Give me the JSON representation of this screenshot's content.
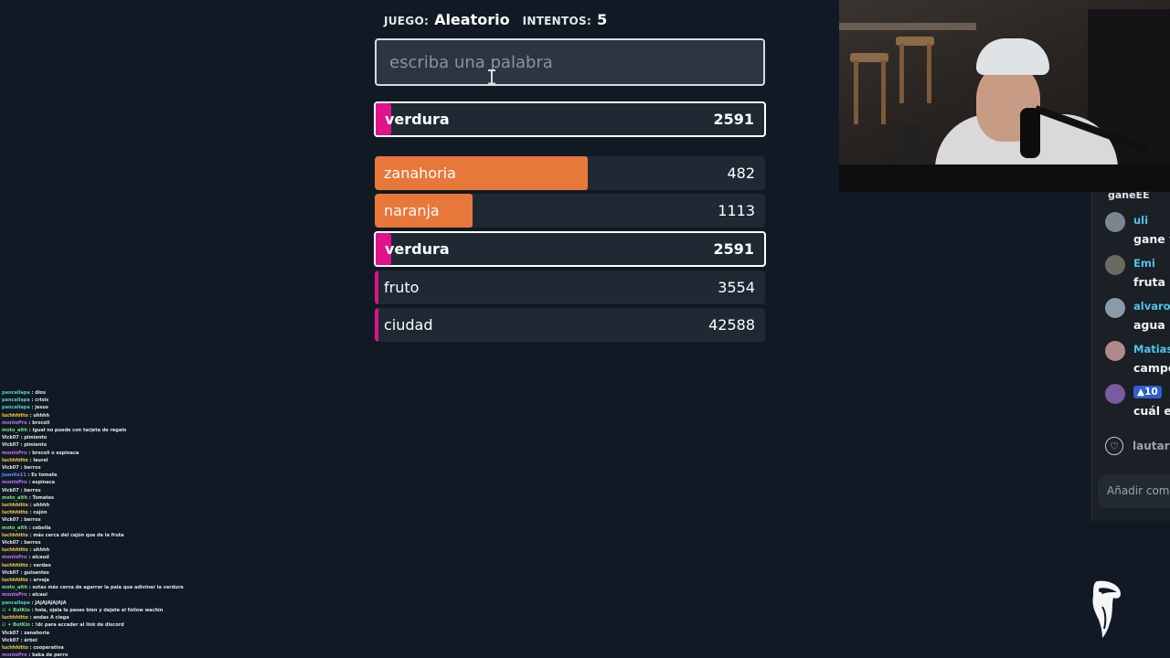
{
  "header": {
    "game_label": "JUEGO:",
    "game_value": "Aleatorio",
    "attempts_label": "INTENTOS:",
    "attempts_value": "5"
  },
  "input": {
    "placeholder": "escriba una palabra",
    "value": ""
  },
  "current_guess": {
    "word": "verdura",
    "rank": "2591",
    "bar_fraction": 0.04,
    "bar_color": "#e0128c"
  },
  "guesses": [
    {
      "word": "zanahoria",
      "rank": "482",
      "bar_fraction": 0.545,
      "bar_color": "#e8773a",
      "highlight": false
    },
    {
      "word": "naranja",
      "rank": "1113",
      "bar_fraction": 0.25,
      "bar_color": "#e8773a",
      "highlight": false
    },
    {
      "word": "verdura",
      "rank": "2591",
      "bar_fraction": 0.04,
      "bar_color": "#e0128c",
      "highlight": true
    },
    {
      "word": "fruto",
      "rank": "3554",
      "bar_fraction": 0.01,
      "bar_color": "#e0128c",
      "highlight": false
    },
    {
      "word": "ciudad",
      "rank": "42588",
      "bar_fraction": 0.01,
      "bar_color": "#e0128c",
      "highlight": false
    }
  ],
  "side_chat": {
    "cutoff_text": "ganeEE",
    "messages": [
      {
        "user": "uli",
        "text": "gane y",
        "avatar_color": "#7a8590"
      },
      {
        "user": "Emi",
        "text": "fruta",
        "avatar_color": "#6a6a60"
      },
      {
        "user": "alvaros",
        "text": "agua",
        "avatar_color": "#8a9aa8"
      },
      {
        "user": "Matias",
        "text": "campo",
        "avatar_color": "#b08a8a"
      },
      {
        "user": "10",
        "text": "cuál era",
        "avatar_color": "#7a5aa0",
        "badge": "▲10"
      }
    ],
    "like_user": "lautaro",
    "comment_placeholder": "Añadir come"
  },
  "colors": {
    "background": "#111a24",
    "row_background": "#1e2933",
    "orange_bar": "#e8773a",
    "pink_bar": "#e0128c",
    "username_cyan": "#4fc3e8"
  },
  "chat_log": [
    {
      "user": "pancaIlapa",
      "text": "dios",
      "color": "#4fd1c5"
    },
    {
      "user": "pancaIlapa",
      "text": "crisis",
      "color": "#4fd1c5"
    },
    {
      "user": "pancaIlapa",
      "text": "jesus",
      "color": "#4fd1c5"
    },
    {
      "user": "luchhhitto",
      "text": "uhhhh",
      "color": "#f6c945"
    },
    {
      "user": "montoPro",
      "text": "brocoli",
      "color": "#c070f0"
    },
    {
      "user": "moto_alth",
      "text": "igual no puede con tarjeta de regalo",
      "color": "#7be07b"
    },
    {
      "user": "Vick07",
      "text": "pimiento",
      "color": "#dfe3e6"
    },
    {
      "user": "Vick07",
      "text": "pimiento",
      "color": "#dfe3e6"
    },
    {
      "user": "montoPro",
      "text": "brocoli o espinaca",
      "color": "#c070f0"
    },
    {
      "user": "luchhhitto",
      "text": "laurel",
      "color": "#f6c945"
    },
    {
      "user": "Vick07",
      "text": "berros",
      "color": "#dfe3e6"
    },
    {
      "user": "juanito11",
      "text": "Es tomate",
      "color": "#5b8cff"
    },
    {
      "user": "montoPro",
      "text": "espinaca",
      "color": "#c070f0"
    },
    {
      "user": "Vick07",
      "text": "berros",
      "color": "#dfe3e6"
    },
    {
      "user": "moto_alth",
      "text": "Tomates",
      "color": "#7be07b"
    },
    {
      "user": "luchhhitto",
      "text": "uhhhh",
      "color": "#f6c945"
    },
    {
      "user": "luchhhitto",
      "text": "cajón",
      "color": "#f6c945"
    },
    {
      "user": "Vick07",
      "text": "berros",
      "color": "#dfe3e6"
    },
    {
      "user": "moto_alth",
      "text": "cebolla",
      "color": "#7be07b"
    },
    {
      "user": "luchhhitto",
      "text": "más cerca del cajón que de la fruta",
      "color": "#f6c945"
    },
    {
      "user": "Vick07",
      "text": "berros",
      "color": "#dfe3e6"
    },
    {
      "user": "luchhhitto",
      "text": "uhhhh",
      "color": "#f6c945"
    },
    {
      "user": "montoPro",
      "text": "alcaud",
      "color": "#c070f0"
    },
    {
      "user": "luchhhitto",
      "text": "verdeo",
      "color": "#f6c945"
    },
    {
      "user": "Vick07",
      "text": "guisantes",
      "color": "#dfe3e6"
    },
    {
      "user": "luchhhitto",
      "text": "arveja",
      "color": "#f6c945"
    },
    {
      "user": "moto_alth",
      "text": "estas más cerca de agarrar la pala que adivinar la verdura",
      "color": "#7be07b"
    },
    {
      "user": "montoPro",
      "text": "alcaui",
      "color": "#c070f0"
    },
    {
      "user": "pancaIlapa",
      "text": "JAJAJAJAJAJA",
      "color": "#4fd1c5"
    },
    {
      "user": "☑ ✦ BotKio",
      "text": "hola, ojala la pases bien y dejate el follow wachin",
      "color": "#7be07b"
    },
    {
      "user": "luchhhitto",
      "text": "andas A ciega",
      "color": "#f6c945"
    },
    {
      "user": "☑ ✦ BotKio",
      "text": "!dc para acceder al link de discord",
      "color": "#7be07b"
    },
    {
      "user": "Vick07",
      "text": "zanahoria",
      "color": "#dfe3e6"
    },
    {
      "user": "Vick07",
      "text": "árbol",
      "color": "#dfe3e6"
    },
    {
      "user": "luchhhitto",
      "text": "cooperativa",
      "color": "#f6c945"
    },
    {
      "user": "montoPro",
      "text": "kaka de perro",
      "color": "#c070f0"
    }
  ]
}
